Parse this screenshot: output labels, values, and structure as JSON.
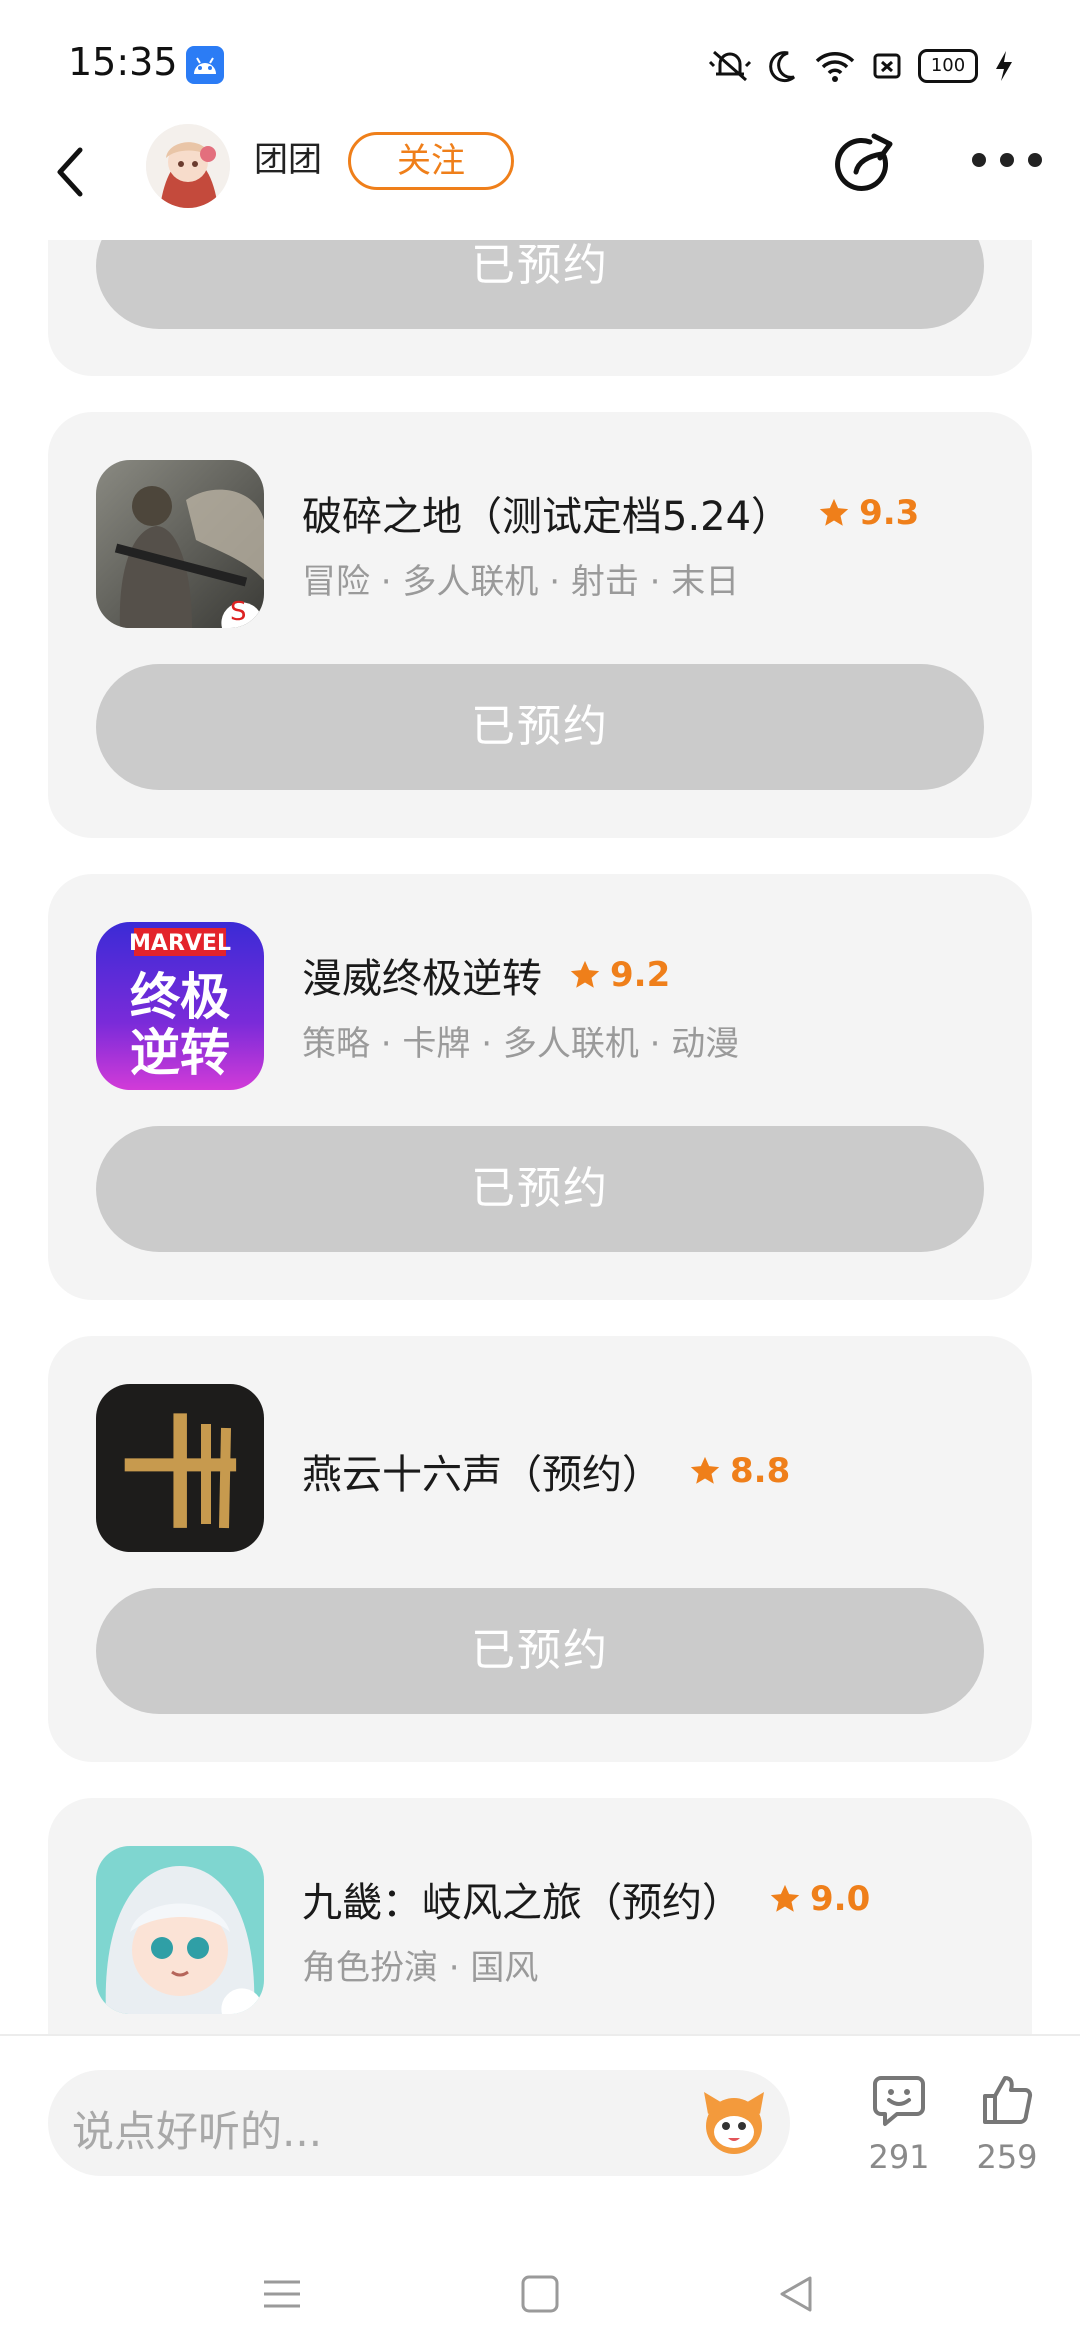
{
  "status_bar": {
    "time": "15:35",
    "battery": "100",
    "icons": [
      "android-app-icon",
      "mute-icon",
      "moon-icon",
      "wifi-icon",
      "sim-off-icon",
      "battery-icon",
      "charging-icon"
    ]
  },
  "header": {
    "author_name": "团团",
    "follow_label": "关注",
    "icons": [
      "back-icon",
      "share-icon",
      "more-icon"
    ]
  },
  "colors": {
    "accent": "#ef7f1a",
    "card_bg": "#f4f4f4",
    "button_disabled": "#cbcbcb"
  },
  "games": [
    {
      "title": "",
      "rating": "",
      "tags": "",
      "button_label": "已预约"
    },
    {
      "title": "破碎之地（测试定档5.24）",
      "rating": "9.3",
      "tags": "冒险 · 多人联机 · 射击 · 末日",
      "button_label": "已预约",
      "icon": "soldier-game-icon"
    },
    {
      "title": "漫威终极逆转",
      "rating": "9.2",
      "tags": "策略 · 卡牌 · 多人联机 · 动漫",
      "button_label": "已预约",
      "icon": "marvel-game-icon",
      "icon_text": [
        "MARVEL",
        "终极",
        "逆转"
      ]
    },
    {
      "title": "燕云十六声（预约）",
      "rating": "8.8",
      "tags": "",
      "button_label": "已预约",
      "icon": "yanyun-game-icon",
      "icon_text": "十"
    },
    {
      "title": "九畿：岐风之旅（预约）",
      "rating": "9.0",
      "tags": "角色扮演 · 国风",
      "icon": "anime-girl-game-icon"
    }
  ],
  "bottom_bar": {
    "comment_placeholder": "说点好听的...",
    "comment_count": "291",
    "like_count": "259"
  }
}
